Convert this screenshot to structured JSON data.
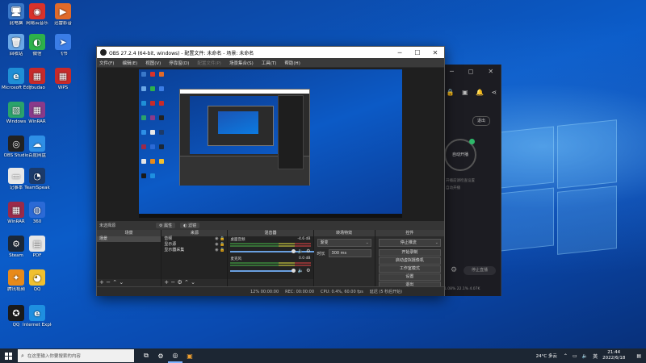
{
  "desktop": {
    "icons": [
      {
        "label": "此电脑",
        "color": "#3a78c9",
        "glyph": "🖥"
      },
      {
        "label": "网易云音乐",
        "color": "#d9322a",
        "glyph": "◉"
      },
      {
        "label": "迅雷影音",
        "color": "#e06a2a",
        "glyph": "▶"
      },
      {
        "label": "回收站",
        "color": "#6aa7e6",
        "glyph": "🗑"
      },
      {
        "label": "微信",
        "color": "#2db14b",
        "glyph": "◐"
      },
      {
        "label": "飞书",
        "color": "#3b7de6",
        "glyph": "➤"
      },
      {
        "label": "Microsoft Edge",
        "color": "#1f8fd6",
        "glyph": "e"
      },
      {
        "label": "Youdao",
        "color": "#c72a2a",
        "glyph": "▦"
      },
      {
        "label": "WPS",
        "color": "#c72a2a",
        "glyph": "▦"
      },
      {
        "label": "Windows",
        "color": "#2aa36b",
        "glyph": "▧"
      },
      {
        "label": "WinRAR",
        "color": "#8a3a8a",
        "glyph": "▦"
      },
      {
        "label": "OBS Studio",
        "color": "#222222",
        "glyph": "◎"
      },
      {
        "label": "百度网盘",
        "color": "#2e8fe6",
        "glyph": "☁"
      },
      {
        "label": "记事本",
        "color": "#e8e8e8",
        "glyph": "▭"
      },
      {
        "label": "TeamSpeak",
        "color": "#1b3a6a",
        "glyph": "◔"
      },
      {
        "label": "WinRAR",
        "color": "#9a2a4a",
        "glyph": "▦"
      },
      {
        "label": "360",
        "color": "#2b6ad6",
        "glyph": "◍"
      },
      {
        "label": "Steam",
        "color": "#1b2838",
        "glyph": "⚙"
      },
      {
        "label": "PDF",
        "color": "#e6e6e6",
        "glyph": "▤"
      },
      {
        "label": "腾讯视频",
        "color": "#e88a1a",
        "glyph": "✦"
      },
      {
        "label": "QQ",
        "color": "#f0c030",
        "glyph": "◕"
      },
      {
        "label": "QQ",
        "color": "#1a1a1a",
        "glyph": "✪"
      },
      {
        "label": "Internet Explorer",
        "color": "#1e8fe0",
        "glyph": "e"
      }
    ]
  },
  "obs": {
    "title": "OBS 27.2.4 (64-bit, windows) - 配置文件: 未命名 - 场景: 未命名",
    "menu": [
      "文件(F)",
      "编辑(E)",
      "视图(V)",
      "停靠窗(D)",
      "配置文件(P)",
      "场景集合(S)",
      "工具(T)",
      "帮助(H)"
    ],
    "menu_dim": [
      4
    ],
    "context": {
      "no_source": "未选择源",
      "props": "属性",
      "filters": "滤镜"
    },
    "scenes": {
      "header": "场景",
      "items": [
        "场景"
      ]
    },
    "sources": {
      "header": "来源",
      "items": [
        "音频",
        "显示源",
        "显示器采集"
      ]
    },
    "mixer": {
      "header": "混音器",
      "channels": [
        {
          "name": "桌面音频",
          "db": "-4.6 dB"
        },
        {
          "name": "麦克风",
          "db": "0.0 dB"
        }
      ]
    },
    "transitions": {
      "header": "转场特效",
      "type": "渐变",
      "duration_label": "时长",
      "duration": "300 ms"
    },
    "controls": {
      "header": "控件",
      "buttons": [
        "停止推流",
        "开始录制",
        "启动虚拟摄像机",
        "工作室模式",
        "设置",
        "退出"
      ]
    },
    "status": [
      "12% 00:00:00",
      "REC: 00:00:00",
      "CPU: 0.4%, 60.00 fps",
      "延迟 (5 秒后开始)"
    ]
  },
  "bgapp": {
    "exit": "退出",
    "live": "自动开播",
    "hint1": "开播前请检查设置",
    "hint2": "自动开播",
    "stop": "停止直播",
    "stat": "1.08% 22.1% 4.07K"
  },
  "taskbar": {
    "search_placeholder": "在这里输入你要搜索的内容",
    "weather": "24°C 多云",
    "ime": "英",
    "time": "21:44",
    "date": "2022/6/18"
  }
}
